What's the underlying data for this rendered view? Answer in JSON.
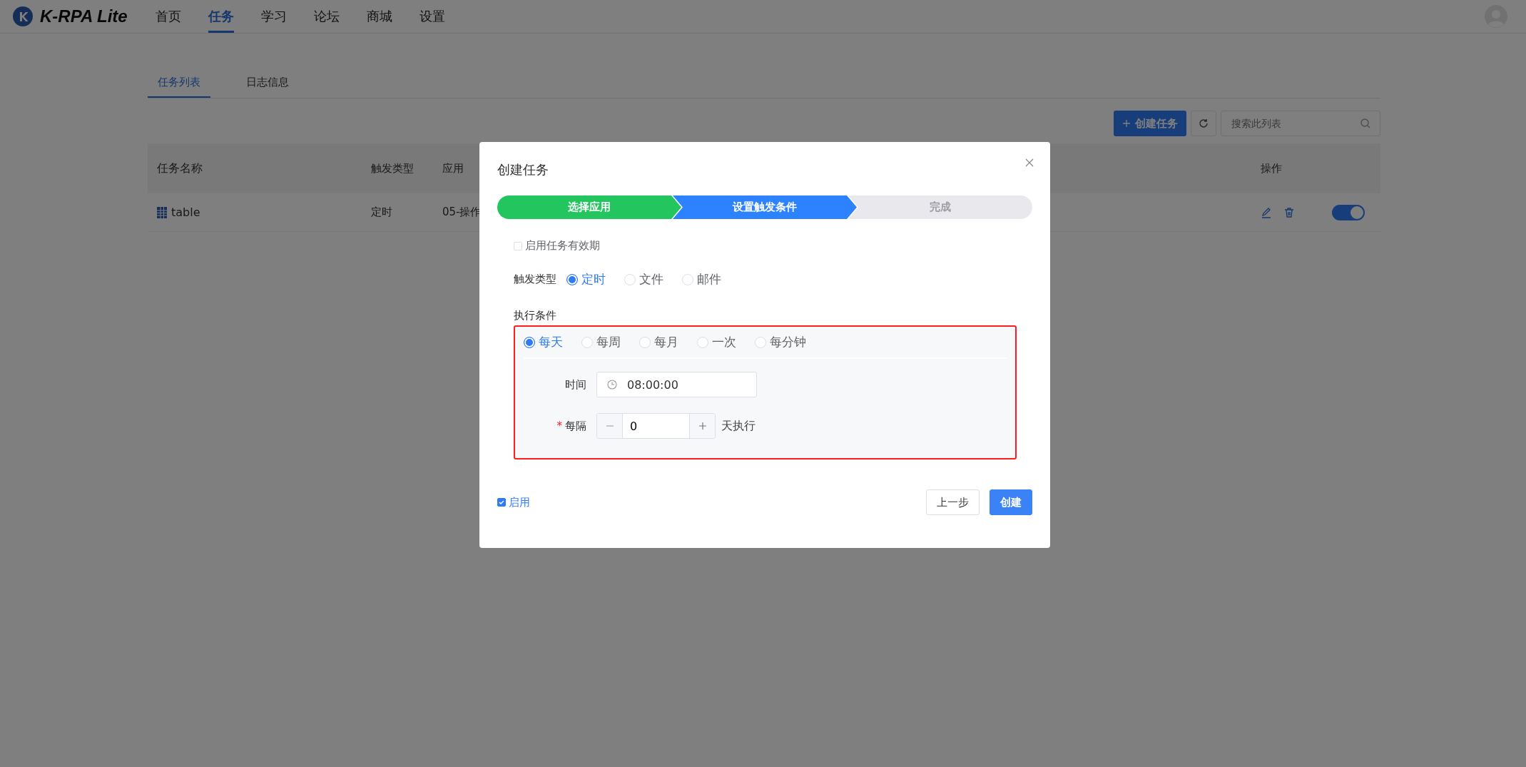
{
  "app": {
    "name": "K-RPA Lite"
  },
  "nav": [
    {
      "label": "首页",
      "selected": false
    },
    {
      "label": "任务",
      "selected": true
    },
    {
      "label": "学习",
      "selected": false
    },
    {
      "label": "论坛",
      "selected": false
    },
    {
      "label": "商城",
      "selected": false
    },
    {
      "label": "设置",
      "selected": false
    }
  ],
  "page_tabs": [
    {
      "label": "任务列表",
      "selected": true
    },
    {
      "label": "日志信息",
      "selected": false
    }
  ],
  "toolbar": {
    "create_button": "创建任务",
    "search": {
      "placeholder": "搜索此列表"
    }
  },
  "table": {
    "columns": [
      "任务名称",
      "触发类型",
      "应用",
      "操作"
    ],
    "rows": [
      {
        "name": "table",
        "trigger": "定时",
        "app": "05-操作",
        "on": true
      }
    ]
  },
  "dialog": {
    "title": "创建任务",
    "steps": [
      {
        "label": "选择应用",
        "kind": "done"
      },
      {
        "label": "设置触发条件",
        "kind": "active"
      },
      {
        "label": "完成",
        "kind": "todo"
      }
    ],
    "validity": {
      "label": "启用任务有效期",
      "checked": false
    },
    "trigger_type": {
      "label": "触发类型",
      "options": [
        {
          "label": "定时",
          "selected": true
        },
        {
          "label": "文件",
          "selected": false
        },
        {
          "label": "邮件",
          "selected": false
        }
      ]
    },
    "condition": {
      "label": "执行条件",
      "highlighted": true,
      "frequency": [
        {
          "label": "每天",
          "selected": true
        },
        {
          "label": "每周",
          "selected": false
        },
        {
          "label": "每月",
          "selected": false
        },
        {
          "label": "一次",
          "selected": false
        },
        {
          "label": "每分钟",
          "selected": false
        }
      ],
      "time": {
        "label": "时间",
        "value": "08:00:00"
      },
      "interval": {
        "required_mark": "*",
        "label": "每隔",
        "value": "0",
        "unit": "天执行"
      }
    },
    "enable": {
      "label": "启用",
      "checked": true
    },
    "buttons": [
      {
        "label": "上一步",
        "kind": "secondary"
      },
      {
        "label": "创建",
        "kind": "primary"
      }
    ]
  }
}
